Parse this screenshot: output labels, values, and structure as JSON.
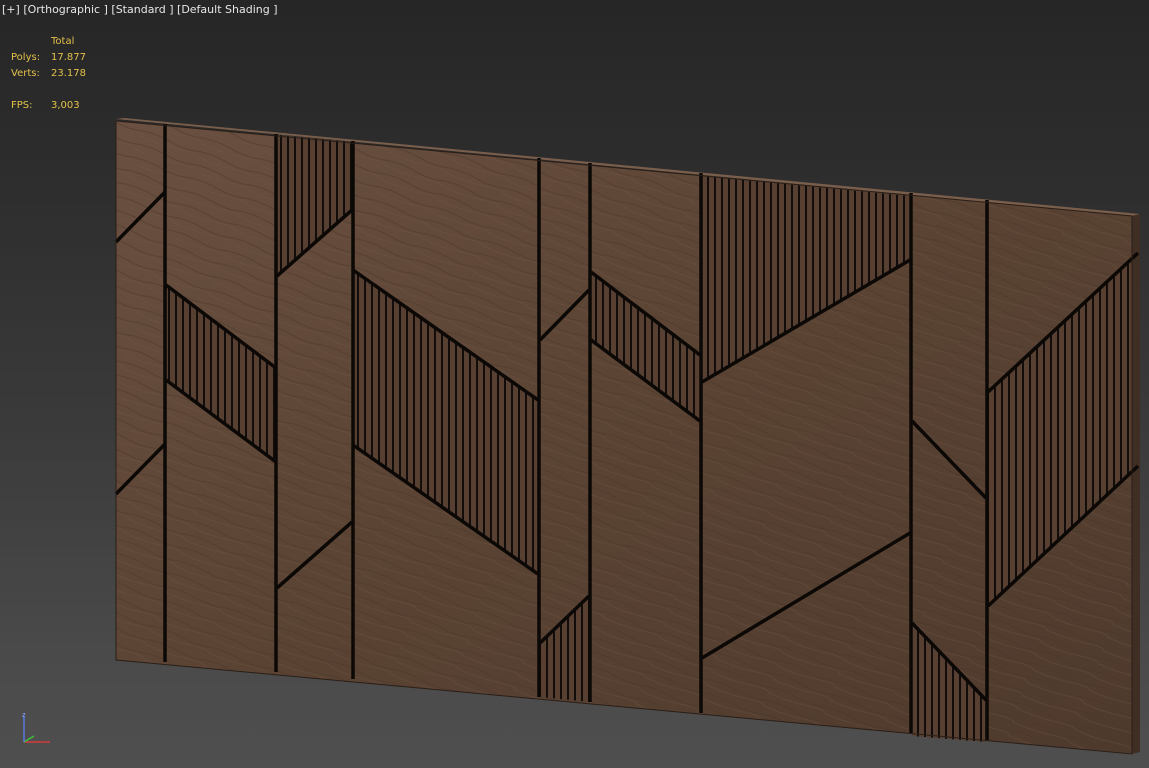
{
  "viewport": {
    "label_parts": [
      "[+]",
      "[Orthographic ]",
      "[Standard ]",
      "[Default Shading ]"
    ],
    "stats": {
      "header": "Total",
      "polys_label": "Polys:",
      "polys_value": "17.877",
      "verts_label": "Verts:",
      "verts_value": "23.178",
      "fps_label": "FPS:",
      "fps_value": "3,003"
    },
    "axis_gizmo": {
      "z_label": "z",
      "x_color": "#d23b3b",
      "y_color": "#3fbf3f",
      "z_color": "#5a78e0"
    }
  },
  "scene": {
    "object": "wood-wall-panel",
    "wood_color": "#5c4434",
    "groove_color": "#0d0a08",
    "slat_color": "#2a1f18"
  }
}
